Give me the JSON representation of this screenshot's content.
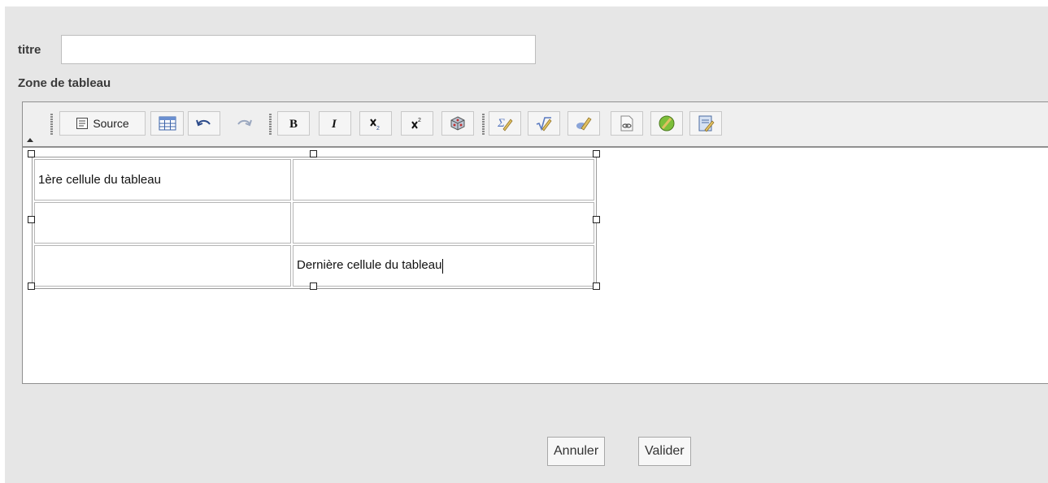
{
  "form": {
    "title_label": "titre",
    "title_value": "",
    "zone_label": "Zone de tableau"
  },
  "toolbar": {
    "source_label": "Source",
    "buttons": [
      "table-icon",
      "undo-icon",
      "redo-icon",
      "bold-icon",
      "italic-icon",
      "subscript-icon",
      "superscript-icon",
      "cube-icon",
      "sigma-edit-icon",
      "sqrt-edit-icon",
      "pencil-edit-icon",
      "link-icon",
      "green-ball-icon",
      "notes-icon"
    ]
  },
  "table": {
    "rows": [
      [
        "1ère cellule du tableau",
        ""
      ],
      [
        "",
        ""
      ],
      [
        "",
        "Dernière cellule du tableau"
      ]
    ]
  },
  "actions": {
    "cancel_label": "Annuler",
    "validate_label": "Valider"
  }
}
